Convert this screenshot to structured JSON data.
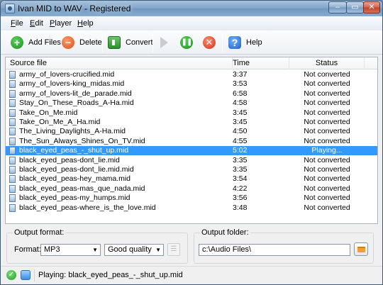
{
  "window": {
    "title": "Ivan MID to WAV - Registered"
  },
  "menu": {
    "items": [
      "File",
      "Edit",
      "Player",
      "Help"
    ]
  },
  "toolbar": {
    "add_label": "Add Files",
    "delete_label": "Delete",
    "convert_label": "Convert",
    "help_label": "Help"
  },
  "list": {
    "columns": {
      "file": "Source file",
      "time": "Time",
      "status": "Status"
    },
    "rows": [
      {
        "file": "army_of_lovers-crucified.mid",
        "time": "3:37",
        "status": "Not converted"
      },
      {
        "file": "army_of_lovers-king_midas.mid",
        "time": "3:53",
        "status": "Not converted"
      },
      {
        "file": "army_of_lovers-lit_de_parade.mid",
        "time": "6:58",
        "status": "Not converted"
      },
      {
        "file": "Stay_On_These_Roads_A-Ha.mid",
        "time": "4:58",
        "status": "Not converted"
      },
      {
        "file": "Take_On_Me.mid",
        "time": "3:45",
        "status": "Not converted"
      },
      {
        "file": "Take_On_Me_A_Ha.mid",
        "time": "3:45",
        "status": "Not converted"
      },
      {
        "file": "The_Living_Daylights_A-Ha.mid",
        "time": "4:50",
        "status": "Not converted"
      },
      {
        "file": "The_Sun_Always_Shines_On_TV.mid",
        "time": "4:55",
        "status": "Not converted"
      },
      {
        "file": "black_eyed_peas_-_shut_up.mid",
        "time": "5:02",
        "status": "Playing..."
      },
      {
        "file": "black_eyed_peas-dont_lie.mid",
        "time": "3:35",
        "status": "Not converted"
      },
      {
        "file": "black_eyed_peas-dont_lie.mid.mid",
        "time": "3:35",
        "status": "Not converted"
      },
      {
        "file": "black_eyed_peas-hey_mama.mid",
        "time": "3:54",
        "status": "Not converted"
      },
      {
        "file": "black_eyed_peas-mas_que_nada.mid",
        "time": "4:22",
        "status": "Not converted"
      },
      {
        "file": "black_eyed_peas-my_humps.mid",
        "time": "3:56",
        "status": "Not converted"
      },
      {
        "file": "black_eyed_peas-where_is_the_love.mid",
        "time": "3:48",
        "status": "Not converted"
      }
    ],
    "selected_index": 8
  },
  "output_format": {
    "group_label": "Output format:",
    "format_label": "Format:",
    "format_value": "MP3",
    "quality_value": "Good quality"
  },
  "output_folder": {
    "group_label": "Output folder:",
    "path": "c:\\Audio Files\\"
  },
  "status": {
    "text": "Playing: black_eyed_peas_-_shut_up.mid"
  },
  "colors": {
    "selection": "#3399ff",
    "accent": "#2162c8"
  }
}
